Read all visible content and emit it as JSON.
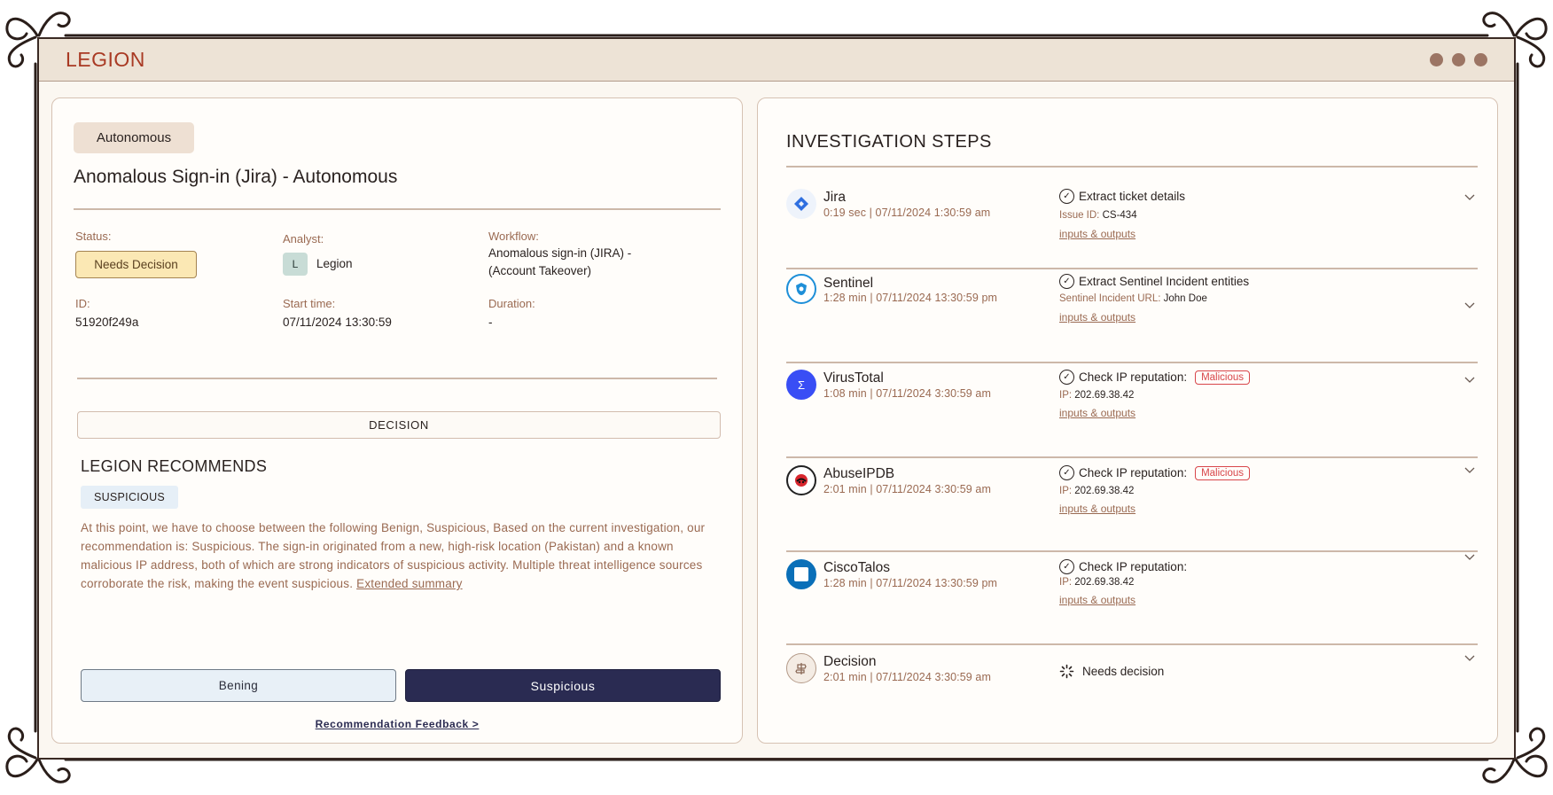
{
  "app": {
    "logo": "LEGION"
  },
  "left": {
    "tag": "Autonomous",
    "title": "Anomalous Sign-in (Jira) - Autonomous",
    "status_label": "Status:",
    "status_value": "Needs Decision",
    "analyst_label": "Analyst:",
    "analyst_initial": "L",
    "analyst_name": "Legion",
    "workflow_label": "Workflow:",
    "workflow_line1": "Anomalous sign-in (JIRA) -",
    "workflow_line2": "(Account Takeover)",
    "id_label": "ID:",
    "id_value": "51920f249a",
    "start_label": "Start time:",
    "start_value": "07/11/2024 13:30:59",
    "duration_label": "Duration:",
    "duration_value": "-",
    "decision_bar": "DECISION",
    "recommends_title": "LEGION RECOMMENDS",
    "verdict": "SUSPICIOUS",
    "summary_text": "At this point, we have to choose between the following Benign, Suspicious, Based on the current investigation, our recommendation is: Suspicious. The sign-in originated from a new, high-risk location (Pakistan) and a known malicious IP address, both of which are strong indicators of suspicious activity. Multiple threat intelligence sources corroborate the risk, making the event suspicious.",
    "summary_link": "Extended summary",
    "btn_benign": "Bening",
    "btn_suspicious": "Suspicious",
    "feedback_link": "Recommendation Feedback >"
  },
  "right": {
    "title": "INVESTIGATION STEPS",
    "steps": [
      {
        "name": "Jira",
        "time": "0:19 sec  |  07/11/2024 1:30:59 am",
        "action": "Extract ticket details",
        "detail_label": "Issue ID:",
        "detail_value": "CS-434",
        "link": "inputs & outputs",
        "icon": "jira-icon",
        "badge": ""
      },
      {
        "name": "Sentinel",
        "time": "1:28 min | 07/11/2024 13:30:59 pm",
        "action": "Extract Sentinel Incident entities",
        "detail_label": "Sentinel Incident URL:",
        "detail_value": "John Doe",
        "link": "inputs & outputs",
        "icon": "sentinel-icon",
        "badge": ""
      },
      {
        "name": "VirusTotal",
        "time": "1:08 min  |  07/11/2024 3:30:59 am",
        "action": "Check IP reputation:",
        "detail_label": "IP:",
        "detail_value": "202.69.38.42",
        "link": "inputs & outputs",
        "icon": "virustotal-icon",
        "badge": "Malicious"
      },
      {
        "name": "AbuseIPDB",
        "time": "2:01 min  |  07/11/2024 3:30:59 am",
        "action": "Check IP reputation:",
        "detail_label": "IP:",
        "detail_value": "202.69.38.42",
        "link": "inputs & outputs",
        "icon": "abuseipdb-icon",
        "badge": "Malicious"
      },
      {
        "name": "CiscoTalos",
        "time": "1:28 min | 07/11/2024 13:30:59 pm",
        "action": "Check IP reputation:",
        "detail_label": "IP:",
        "detail_value": "202.69.38.42",
        "link": "inputs & outputs",
        "icon": "ciscotalos-icon",
        "badge": ""
      },
      {
        "name": "Decision",
        "time": "2:01 min  |  07/11/2024 3:30:59 am",
        "action": "Needs decision",
        "icon": "decision-icon",
        "badge": ""
      }
    ]
  },
  "colors": {
    "brand": "#a93a24",
    "accent_navy": "#2a2b52",
    "muted_text": "#9a6a52",
    "malicious": "#d8464a",
    "status_fill": "#fbe8b4"
  }
}
